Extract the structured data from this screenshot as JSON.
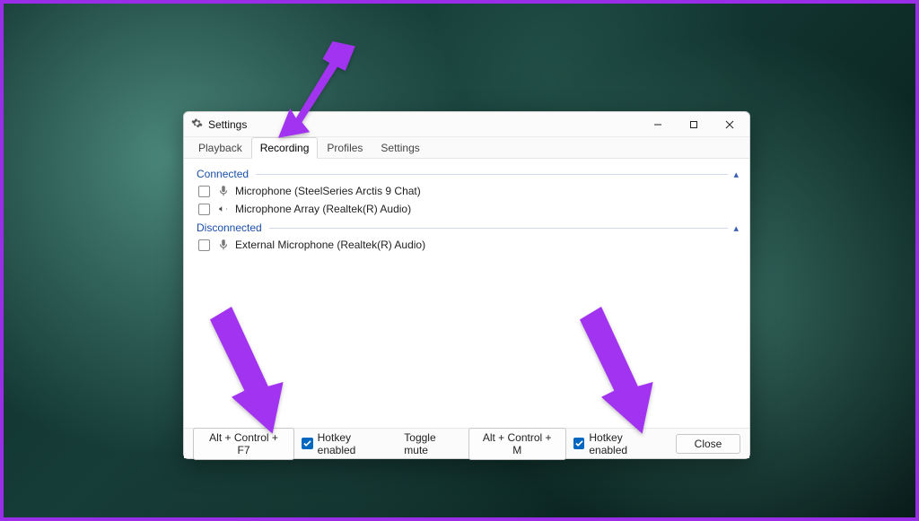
{
  "window": {
    "title": "Settings"
  },
  "tabs": [
    {
      "label": "Playback",
      "active": false
    },
    {
      "label": "Recording",
      "active": true
    },
    {
      "label": "Profiles",
      "active": false
    },
    {
      "label": "Settings",
      "active": false
    }
  ],
  "sections": {
    "connected": {
      "title": "Connected",
      "devices": [
        {
          "name": "Microphone (SteelSeries Arctis 9 Chat)"
        },
        {
          "name": "Microphone Array (Realtek(R) Audio)"
        }
      ]
    },
    "disconnected": {
      "title": "Disconnected",
      "devices": [
        {
          "name": "External Microphone (Realtek(R) Audio)"
        }
      ]
    }
  },
  "footer": {
    "hotkey1_value": "Alt + Control + F7",
    "hotkey1_enabled_label": "Hotkey enabled",
    "toggle_mute_label": "Toggle mute",
    "hotkey2_value": "Alt + Control + M",
    "hotkey2_enabled_label": "Hotkey enabled",
    "close_label": "Close"
  },
  "colors": {
    "accent": "#a233f0",
    "link": "#1a4fa8",
    "checkbox": "#0067c0"
  }
}
